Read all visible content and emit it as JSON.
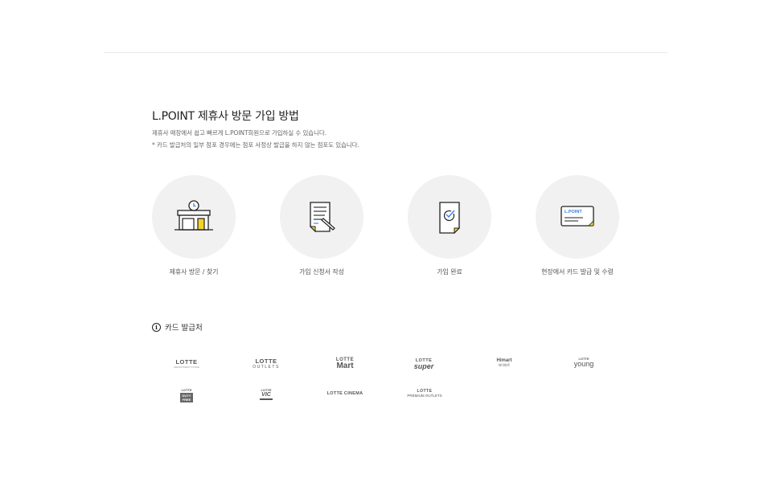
{
  "page": {
    "title": "L.POINT 제휴사 방문 가입 방법",
    "desc_line1": "제휴사 매장에서 쉽고 빠르게 L.POINT회원으로 가입하실 수 있습니다.",
    "desc_line2": "* 카드 발급처의 일부 점포 경우에는 점포 사정상 발급을 하지 않는 점포도 있습니다."
  },
  "steps": [
    {
      "label": "제휴사 방문 / 찾기",
      "icon": "store-icon"
    },
    {
      "label": "가입 신청서 작성",
      "icon": "form-pen-icon"
    },
    {
      "label": "가입 완료",
      "icon": "check-document-icon"
    },
    {
      "label": "현장에서 카드 발급 및 수령",
      "icon": "lpoint-card-icon"
    }
  ],
  "card_text": "L.POINT",
  "issuers": {
    "info_glyph": "i",
    "title": "카드 발급처",
    "logos": [
      {
        "top": "LOTTE",
        "sub": "DEPARTMENT STORE"
      },
      {
        "top": "LOTTE",
        "sub": "OUTLETS"
      },
      {
        "top": "LOTTE",
        "sub": "Mart"
      },
      {
        "top": "LOTTE",
        "sub": "super"
      },
      {
        "top": "Himart",
        "sub": "하이마트"
      },
      {
        "top": "LOTTE",
        "sub": "young"
      },
      {
        "top": "LOTTE",
        "sub": "DUTY FREE"
      },
      {
        "top": "LOTTE",
        "sub": "VIC"
      },
      {
        "top": "LOTTE CINEMA",
        "sub": ""
      },
      {
        "top": "LOTTE",
        "sub": "PREMIUM OUTLETS"
      }
    ]
  },
  "colors": {
    "accent_yellow": "#f2d32a",
    "accent_blue": "#3f7de0",
    "circle_bg": "#f1f1f1"
  }
}
